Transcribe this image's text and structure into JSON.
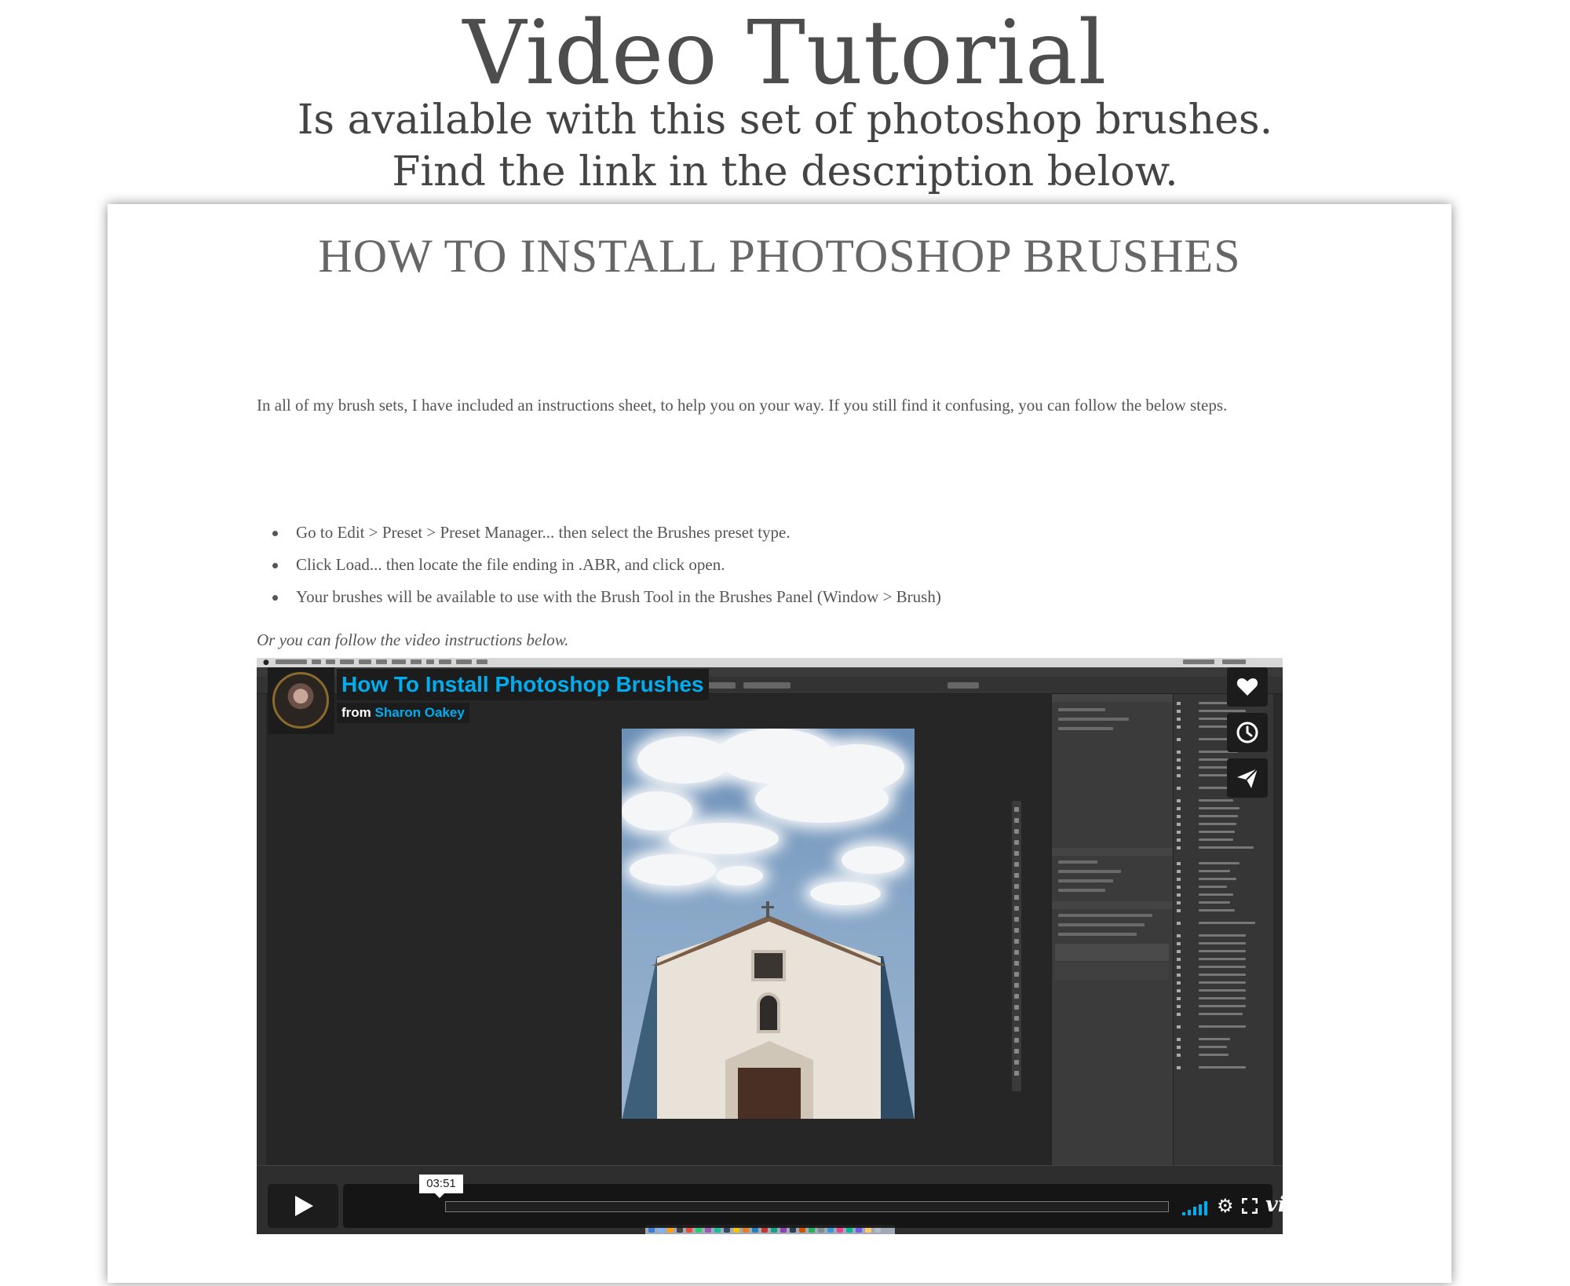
{
  "banner": {
    "title": "Video Tutorial",
    "line1": "Is available with this set of photoshop brushes.",
    "line2": "Find the link in the description below."
  },
  "card": {
    "title": "HOW TO INSTALL PHOTOSHOP BRUSHES",
    "intro": "In all of my brush sets, I have included an instructions sheet, to help you on your way. If you still find it confusing, you can follow the below steps.",
    "steps": [
      "Go to Edit > Preset > Preset Manager... then select the Brushes preset type.",
      "Click Load... then locate the file ending in .ABR, and click open.",
      "Your brushes will be available to use with the Brush Tool in the Brushes Panel (Window > Brush)"
    ],
    "video_hint": "Or you can follow the video instructions below."
  },
  "video": {
    "title": "How To Install Photoshop Brushes",
    "from_label": "from",
    "author": "Sharon Oakey",
    "time": "03:51",
    "progress": 0.0,
    "volume_level": 1.0,
    "logo": "vimeo",
    "side_buttons": [
      "heart-icon",
      "clock-icon",
      "paper-plane-icon"
    ],
    "accent_color": "#00adef"
  }
}
